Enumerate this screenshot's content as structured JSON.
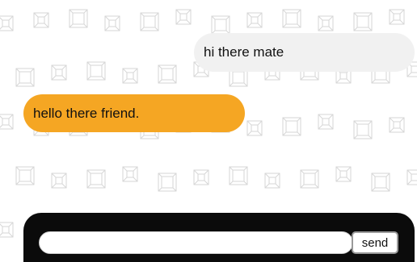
{
  "colors": {
    "background": "#ffffff",
    "pattern_stroke": "#d6d6d6",
    "incoming_bubble": "#f1f1f1",
    "outgoing_bubble": "#f5a623",
    "composer_bar": "#0b0b0b",
    "input_background": "#ffffff"
  },
  "messages": [
    {
      "side": "incoming",
      "text": "hi there mate"
    },
    {
      "side": "outgoing",
      "text": "hello there friend."
    }
  ],
  "composer": {
    "input_value": "",
    "input_placeholder": "",
    "send_label": "send"
  }
}
